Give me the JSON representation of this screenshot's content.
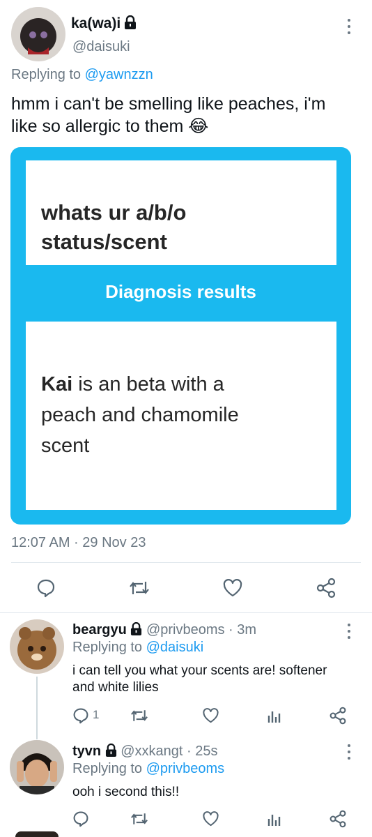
{
  "main_tweet": {
    "display_name": "ka(wa)i",
    "handle": "@daisuki",
    "replying_prefix": "Replying to",
    "replying_to": "@yawnzzn",
    "text_line1": "hmm i can't be smelling like peaches, i'm",
    "text_line2": "like so allergic to them",
    "emoji": "😂",
    "card": {
      "question_line1": "whats ur a/b/o",
      "question_line2": "status/scent",
      "results_header": "Diagnosis results",
      "result_name": "Kai",
      "result_line1_rest": " is an beta with a",
      "result_line2": "peach and chamomile",
      "result_line3": "scent"
    },
    "timestamp": "12:07 AM · 29 Nov 23"
  },
  "replies": [
    {
      "display_name": "beargyu",
      "handle": "@privbeoms",
      "time": " · 3m",
      "replying_prefix": "Replying to",
      "replying_to": "@daisuki",
      "text_line1": "i can tell you what your scents are! softener",
      "text_line2": "and white lilies",
      "reply_count": "1"
    },
    {
      "display_name": "tyvn",
      "handle": "@xxkangt",
      "time": " · 25s",
      "replying_prefix": "Replying to",
      "replying_to": "@privbeoms",
      "text_line1": "ooh i second this!!"
    }
  ],
  "colors": {
    "accent": "#1d9bf0",
    "card_blue": "#1ab9ef",
    "muted": "#6b7883"
  }
}
